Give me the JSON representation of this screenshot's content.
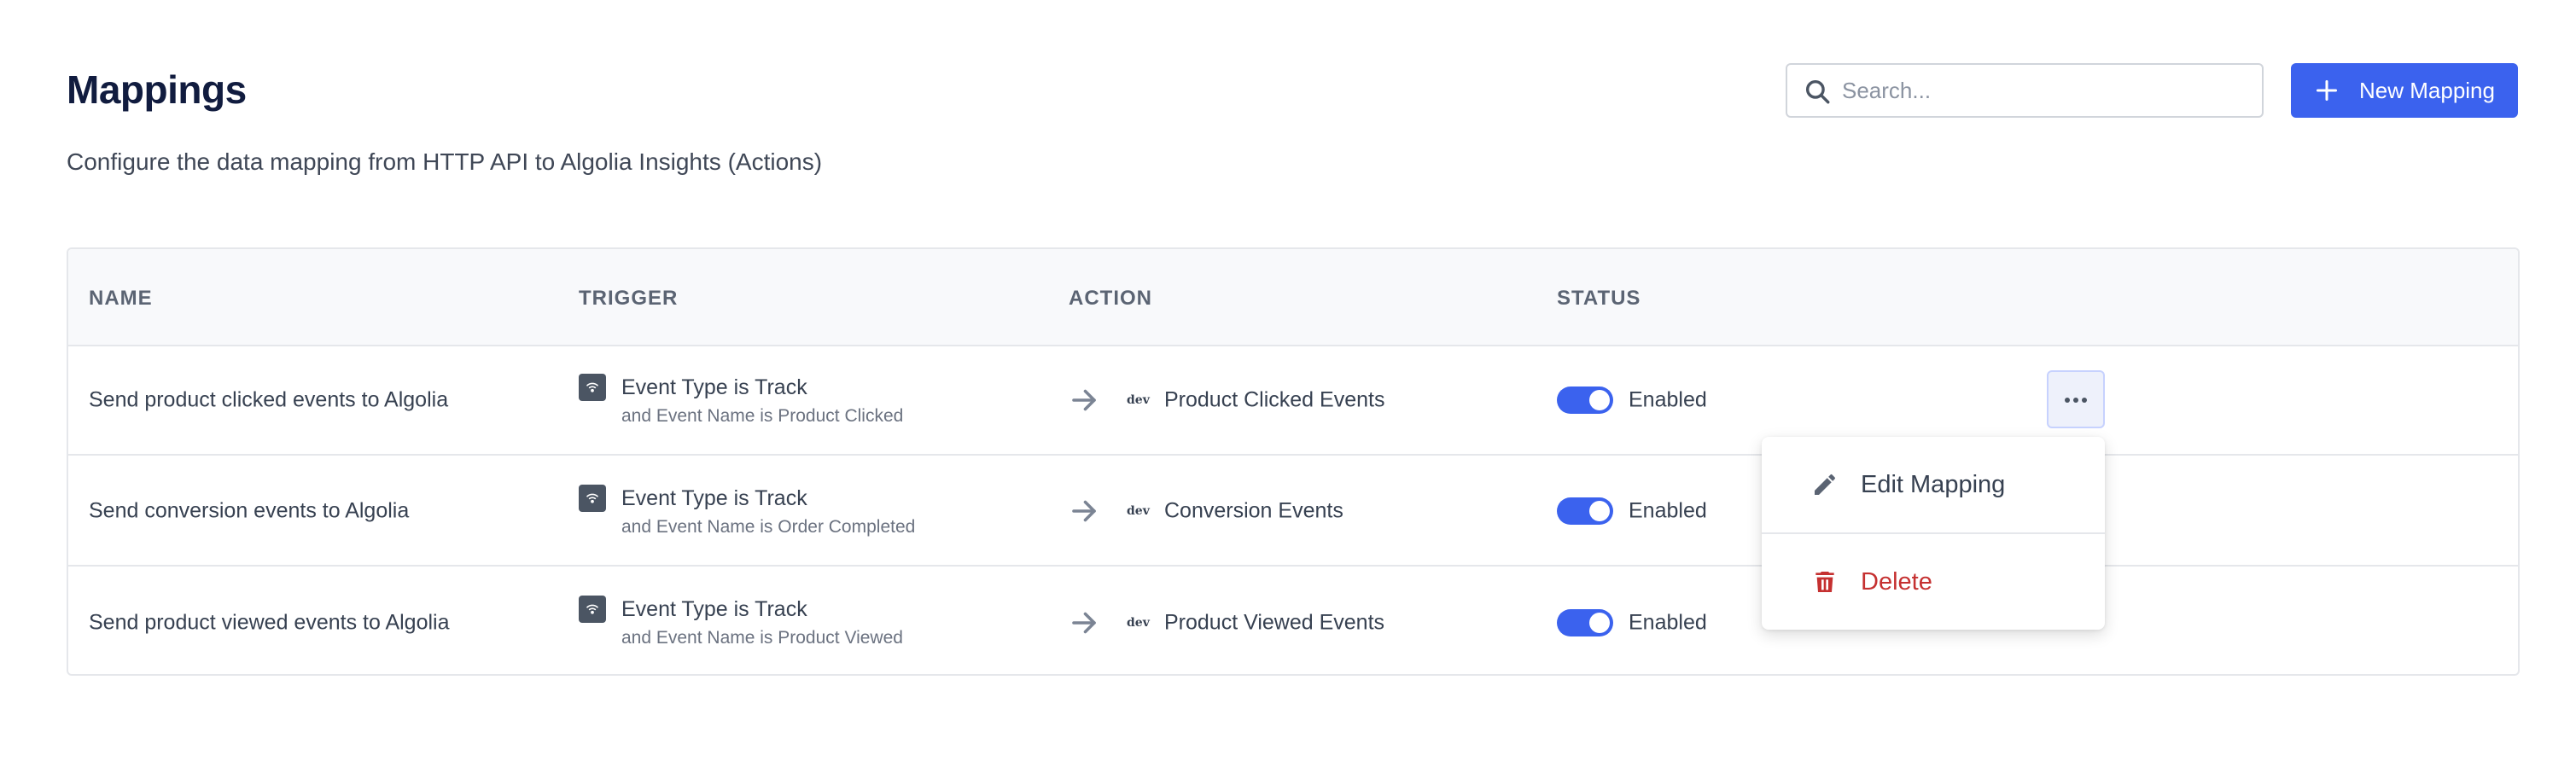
{
  "header": {
    "title": "Mappings",
    "subtitle": "Configure the data mapping from HTTP API to Algolia Insights (Actions)",
    "search_placeholder": "Search...",
    "new_button_label": "New Mapping"
  },
  "table": {
    "columns": [
      "NAME",
      "TRIGGER",
      "ACTION",
      "STATUS"
    ],
    "rows": [
      {
        "name": "Send product clicked events to Algolia",
        "trigger_main": "Event Type is Track",
        "trigger_sub": "and Event Name is Product Clicked",
        "destination_icon_text": "dev",
        "action": "Product Clicked Events",
        "status": "Enabled"
      },
      {
        "name": "Send conversion events to Algolia",
        "trigger_main": "Event Type is Track",
        "trigger_sub": "and Event Name is Order Completed",
        "destination_icon_text": "dev",
        "action": "Conversion Events",
        "status": "Enabled"
      },
      {
        "name": "Send product viewed events to Algolia",
        "trigger_main": "Event Type is Track",
        "trigger_sub": "and Event Name is Product Viewed",
        "destination_icon_text": "dev",
        "action": "Product Viewed Events",
        "status": "Enabled"
      }
    ]
  },
  "menu": {
    "edit_label": "Edit Mapping",
    "delete_label": "Delete"
  },
  "colors": {
    "accent": "#3b62ee",
    "danger": "#c53030",
    "title": "#111c3f"
  },
  "icons": {
    "search": "search-icon",
    "plus": "plus-icon",
    "trigger": "wifi-icon",
    "arrow": "arrow-right-icon",
    "more": "more-horizontal-icon",
    "edit": "pencil-icon",
    "delete": "trash-icon"
  }
}
